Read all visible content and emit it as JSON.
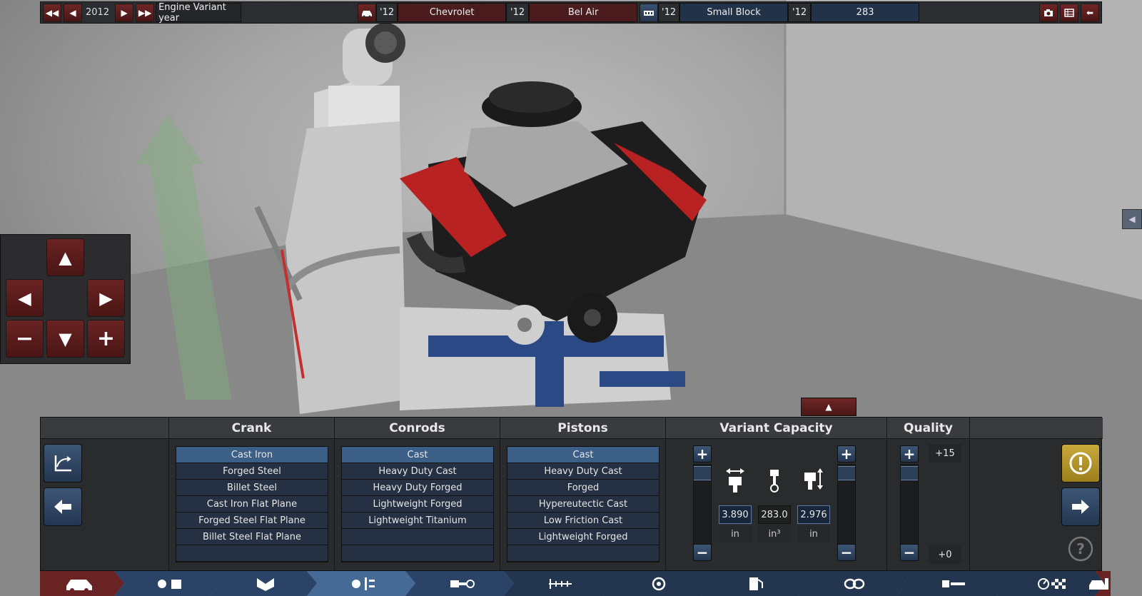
{
  "topbar": {
    "year": "2012",
    "mode_label": "Engine Variant year",
    "make_year": "'12",
    "make": "Chevrolet",
    "model_year": "'12",
    "model": "Bel Air",
    "family_year": "'12",
    "family": "Small Block",
    "variant_year": "'12",
    "variant": "283"
  },
  "colors": {
    "red_accent": "#4b1c1e",
    "blue_accent": "#223349",
    "selected": "#3c5f88",
    "warning": "#b89a2a"
  },
  "sections": {
    "crank": {
      "title": "Crank",
      "items": [
        "Cast Iron",
        "Forged Steel",
        "Billet Steel",
        "Cast Iron Flat Plane",
        "Forged Steel Flat Plane",
        "Billet Steel Flat Plane"
      ],
      "selected": "Cast Iron"
    },
    "conrods": {
      "title": "Conrods",
      "items": [
        "Cast",
        "Heavy Duty Cast",
        "Heavy Duty Forged",
        "Lightweight Forged",
        "Lightweight Titanium"
      ],
      "selected": "Cast"
    },
    "pistons": {
      "title": "Pistons",
      "items": [
        "Cast",
        "Heavy Duty Cast",
        "Forged",
        "Hypereutectic Cast",
        "Low Friction Cast",
        "Lightweight Forged"
      ],
      "selected": "Cast"
    },
    "capacity": {
      "title": "Variant Capacity",
      "bore": "3.890",
      "bore_unit": "in",
      "displacement": "283.0",
      "displacement_unit": "in³",
      "stroke": "2.976",
      "stroke_unit": "in"
    },
    "quality": {
      "title": "Quality",
      "max": "+15",
      "current": "+0"
    }
  },
  "icons": {
    "camera_up": "arrow-up-icon",
    "camera_left": "arrow-left-icon",
    "camera_right": "arrow-right-icon",
    "camera_down": "arrow-down-icon",
    "zoom_out": "minus-icon",
    "zoom_in": "plus-icon",
    "warning": "exclamation-icon",
    "help": "question-icon"
  },
  "nav": [
    "car-icon",
    "engine-family-icon",
    "engine-block-icon",
    "engine-bottom-end-icon",
    "engine-top-end-icon",
    "engine-aspiration-icon",
    "engine-turbo-icon",
    "engine-fuel-icon",
    "engine-exhaust-icon",
    "engine-tune-icon",
    "engine-test-icon",
    "car-design-icon"
  ]
}
